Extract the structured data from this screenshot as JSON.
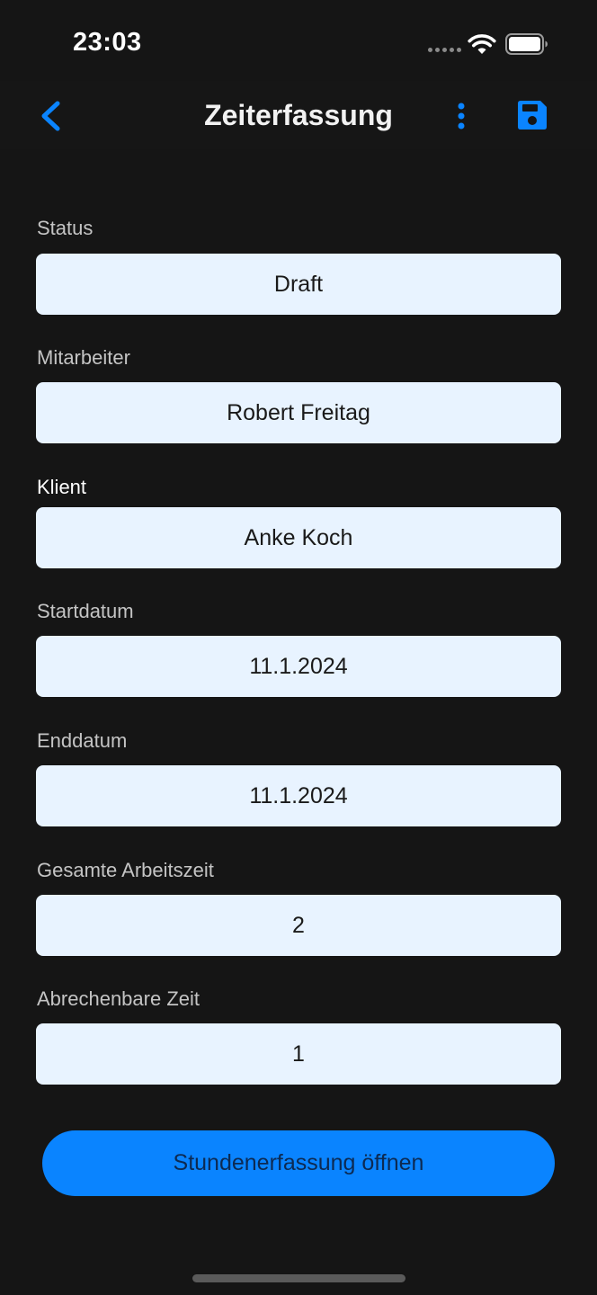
{
  "status_bar": {
    "time": "23:03",
    "wifi_icon": "wifi-icon",
    "battery_icon": "battery-full-icon"
  },
  "nav": {
    "back_icon": "chevron-left-icon",
    "title": "Zeiterfassung",
    "more_icon": "more-vertical-icon",
    "save_icon": "floppy-disk-icon"
  },
  "fields": {
    "status": {
      "label": "Status",
      "value": "Draft"
    },
    "mitarbeiter": {
      "label": "Mitarbeiter",
      "value": "Robert Freitag"
    },
    "klient": {
      "label": "Klient",
      "value": "Anke Koch"
    },
    "startdatum": {
      "label": "Startdatum",
      "value": "11.1.2024"
    },
    "enddatum": {
      "label": "Enddatum",
      "value": "11.1.2024"
    },
    "gesamte_arbeitszeit": {
      "label": "Gesamte Arbeitszeit",
      "value": "2"
    },
    "abrechenbare_zeit": {
      "label": "Abrechenbare Zeit",
      "value": "1"
    }
  },
  "actions": {
    "open_hours_label": "Stundenerfassung öffnen"
  },
  "colors": {
    "background": "#151515",
    "accent": "#0a84ff",
    "field_bg": "#e8f3ff"
  }
}
